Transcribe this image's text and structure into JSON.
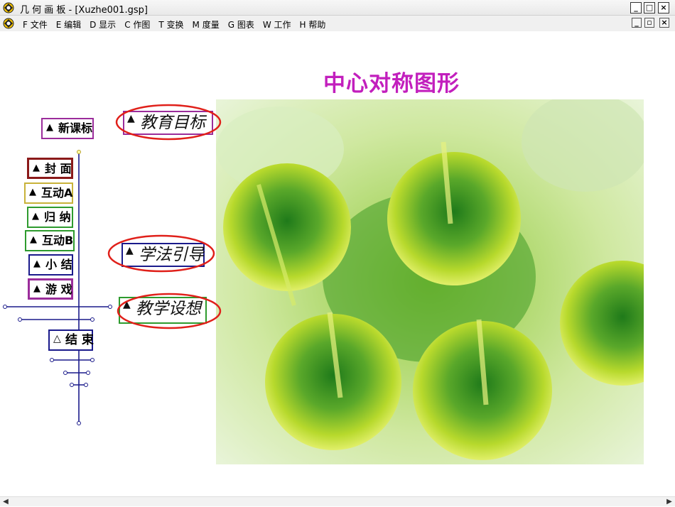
{
  "window": {
    "title": "几 何 画 板 - [Xuzhe001.gsp]"
  },
  "menu": [
    "F 文件",
    "E 编辑",
    "D 显示",
    "C 作图",
    "T 变换",
    "M 度量",
    "G 图表",
    "W 工作",
    "H 帮助"
  ],
  "heading": "中心对称图形",
  "nav_buttons": [
    {
      "label": "新课标",
      "marker": "▲",
      "color": "#9b2d9b"
    },
    {
      "label": "封 面",
      "marker": "▲",
      "color": "#8b1a1a"
    },
    {
      "label": "互动A",
      "marker": "▲",
      "color": "#c8b23a"
    },
    {
      "label": "归 纳",
      "marker": "▲",
      "color": "#2e9b2e"
    },
    {
      "label": "互动B",
      "marker": "▲",
      "color": "#2e9b2e"
    },
    {
      "label": "小 结",
      "marker": "▲",
      "color": "#1a1a8b"
    },
    {
      "label": "游 戏",
      "marker": "▲",
      "color": "#9b2d9b"
    },
    {
      "label": "结 束",
      "marker": "△",
      "color": "#1a1a8b"
    }
  ],
  "section_buttons": [
    {
      "label": "教育目标",
      "marker": "▲",
      "color": "#9b2d9b"
    },
    {
      "label": "学法引导",
      "marker": "▲",
      "color": "#1a1a8b"
    },
    {
      "label": "教学设想",
      "marker": "▲",
      "color": "#2e9b2e"
    }
  ],
  "highlight_color": "#e0201a"
}
